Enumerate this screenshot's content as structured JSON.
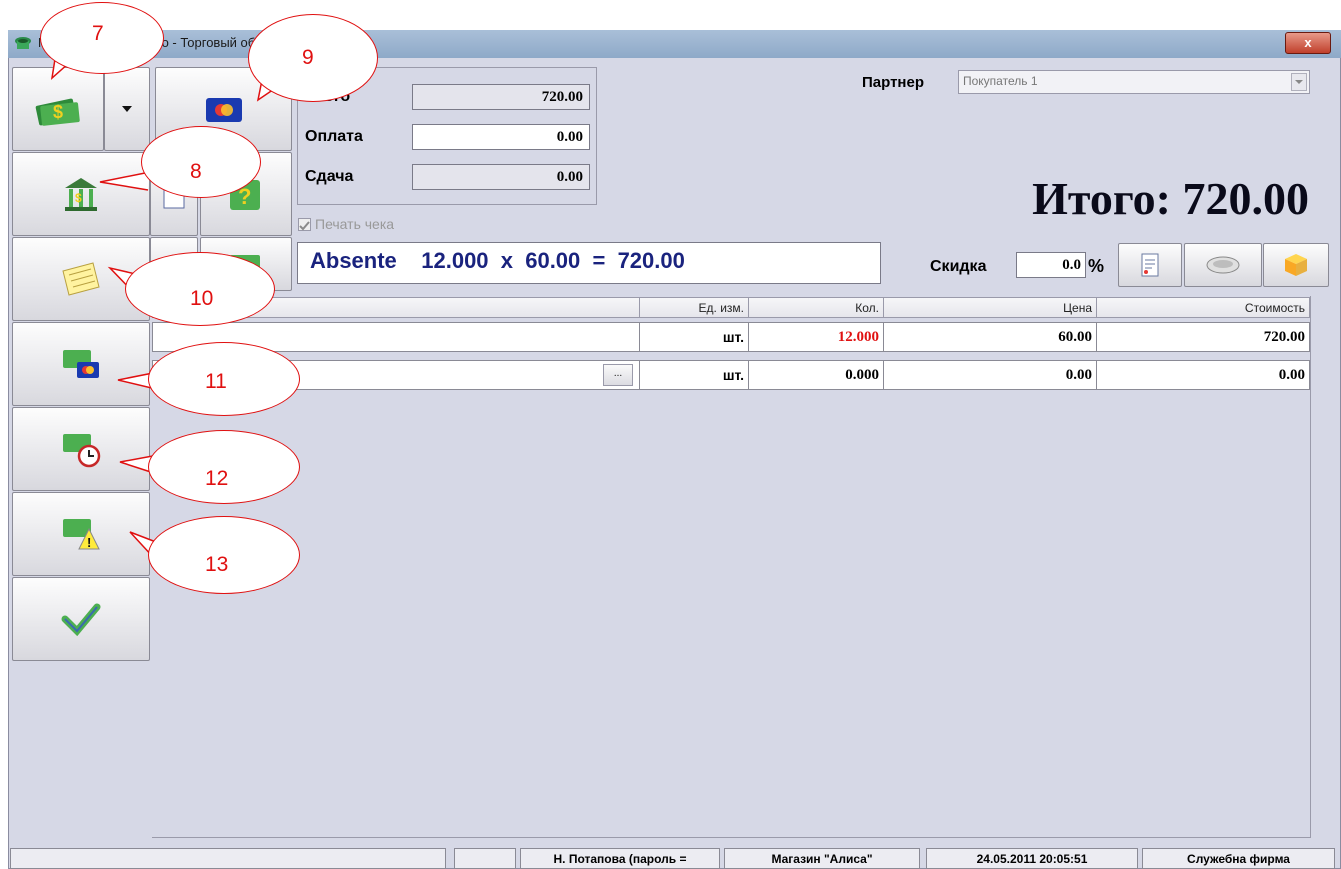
{
  "window": {
    "title": "Microinvest Склад Pro - Торговый объект",
    "close_label": "x"
  },
  "payment": {
    "total_label": "Итого",
    "total_value": "720.00",
    "paid_label": "Оплата",
    "paid_value": "0.00",
    "change_label": "Сдача",
    "change_value": "0.00",
    "print_receipt_label": "Печать чека"
  },
  "partner": {
    "label": "Партнер",
    "value": "Покупатель 1"
  },
  "big_total": "Итого: 720.00",
  "line_display": "Absente    12.000  x  60.00  =  720.00",
  "discount": {
    "label": "Скидка",
    "value": "0.0",
    "unit": "%"
  },
  "table": {
    "headers": {
      "unit": "Ед. изм.",
      "qty": "Кол.",
      "price": "Цена",
      "cost": "Стоимость"
    },
    "rows": [
      {
        "unit": "шт.",
        "qty": "12.000",
        "price": "60.00",
        "cost": "720.00"
      },
      {
        "unit": "шт.",
        "qty": "0.000",
        "price": "0.00",
        "cost": "0.00"
      }
    ],
    "ellipsis_label": "..."
  },
  "status": {
    "operator": "Н. Потапова  (пароль =",
    "store": "Магазин \"Алиса\"",
    "datetime": "24.05.2011 20:05:51",
    "company": "Служебна фирма"
  },
  "callouts": [
    "7",
    "8",
    "9",
    "10",
    "11",
    "12",
    "13"
  ],
  "colors": {
    "accent": "#1a237e",
    "qty_red": "#e01010",
    "callout": "#e01010"
  },
  "icons": [
    "money-icon",
    "card-icon",
    "bank-icon",
    "note-icon",
    "money-card-icon",
    "money-clock-icon",
    "money-warning-icon",
    "checkmark-icon",
    "document-icon",
    "scanner-icon",
    "box-icon"
  ]
}
